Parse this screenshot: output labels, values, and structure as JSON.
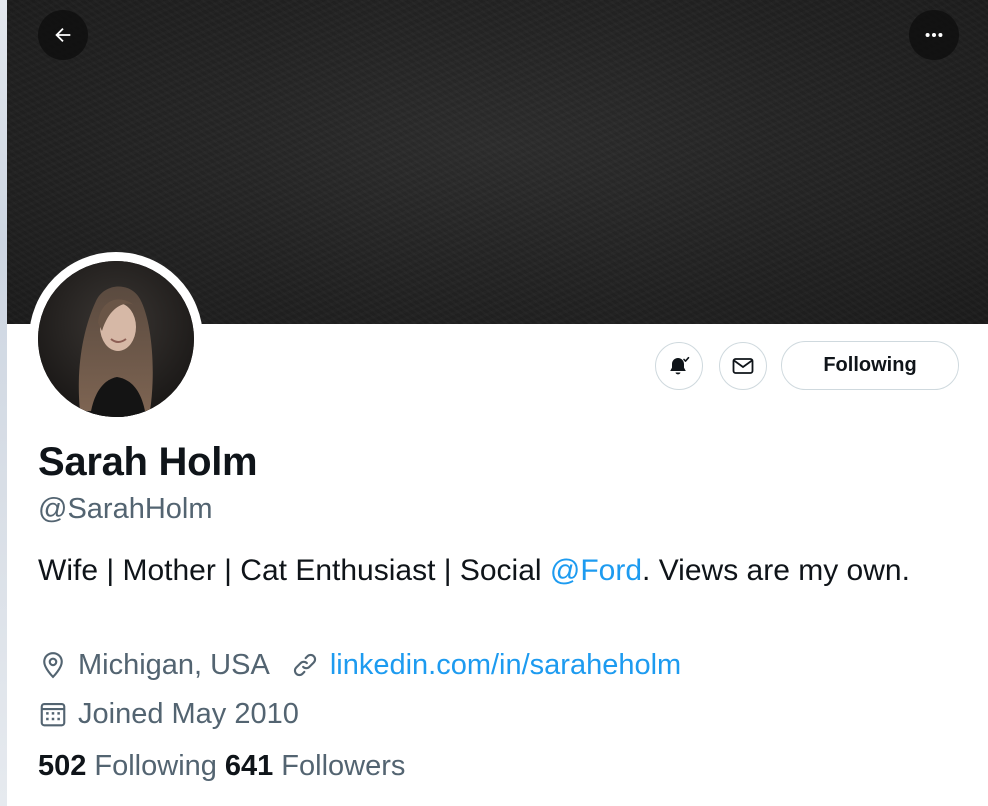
{
  "profile": {
    "display_name": "Sarah Holm",
    "handle": "@SarahHolm",
    "bio_pre": "Wife | Mother | Cat Enthusiast | Social ",
    "bio_mention": "@Ford",
    "bio_post": ". Views are my own.",
    "location": "Michigan, USA",
    "website": "linkedin.com/in/saraheholm",
    "joined": "Joined May 2010"
  },
  "actions": {
    "following_label": "Following"
  },
  "stats": {
    "following_count": "502",
    "following_label": "Following",
    "followers_count": "641",
    "followers_label": "Followers"
  },
  "icons": {
    "back": "arrow-left-icon",
    "more": "more-horizontal-icon",
    "notifications": "bell-check-icon",
    "message": "envelope-icon",
    "location": "location-pin-icon",
    "link": "link-icon",
    "calendar": "calendar-icon"
  },
  "colors": {
    "accent": "#1d9bf0",
    "text_primary": "#0f1419",
    "text_secondary": "#536471",
    "border": "#cfd9de",
    "banner": "#222222"
  }
}
